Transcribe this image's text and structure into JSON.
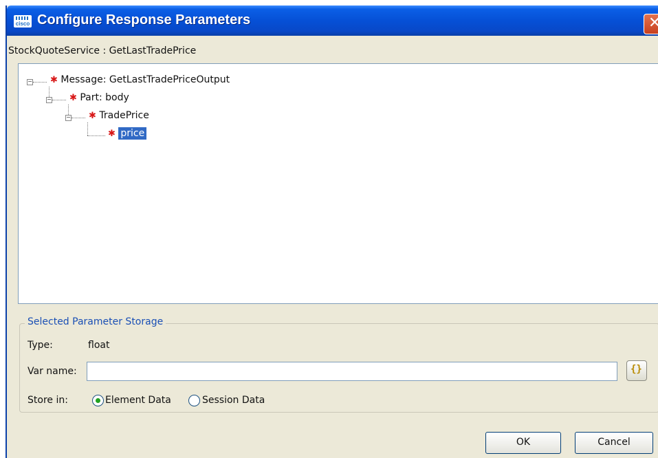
{
  "window": {
    "title": "Configure Response Parameters",
    "app_icon_text": "cisco",
    "close_glyph": "✕"
  },
  "operation_label": "StockQuoteService : GetLastTradePrice",
  "tree": {
    "nodes": [
      {
        "label": "Message: GetLastTradePriceOutput",
        "required_marker": "✱",
        "expander": "−",
        "level": 0
      },
      {
        "label": "Part: body",
        "required_marker": "✱",
        "expander": "−",
        "level": 1
      },
      {
        "label": "TradePrice",
        "required_marker": "✱",
        "expander": "−",
        "level": 2
      },
      {
        "label": "price",
        "required_marker": "✱",
        "level": 3,
        "selected": true
      }
    ]
  },
  "storage": {
    "legend": "Selected Parameter Storage",
    "type_label": "Type:",
    "type_value": "float",
    "var_name_label": "Var name:",
    "var_name_value": "",
    "var_button_glyph": "{}",
    "store_in_label": "Store in:",
    "options": [
      {
        "label": "Element Data",
        "checked": true
      },
      {
        "label": "Session Data",
        "checked": false
      }
    ]
  },
  "buttons": {
    "ok": "OK",
    "cancel": "Cancel"
  },
  "colors": {
    "titlebar": "#0650d6",
    "selection": "#316ac5",
    "required": "#d81818",
    "legend": "#1a4fb5"
  }
}
